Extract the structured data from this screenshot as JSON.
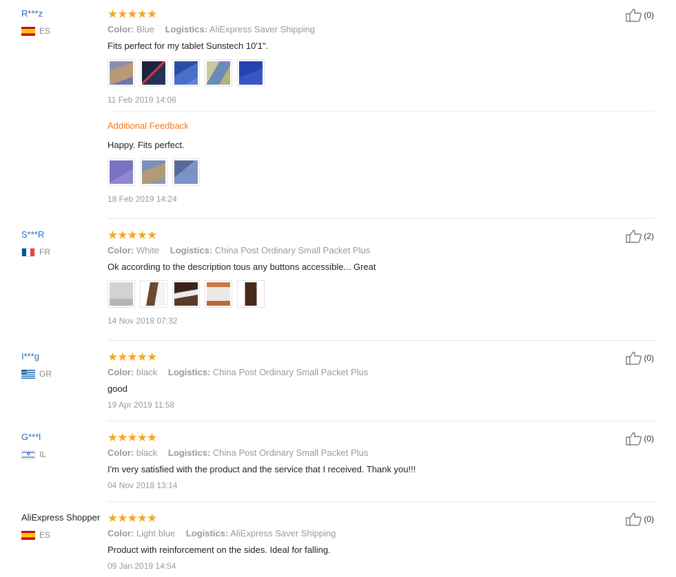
{
  "reviews": [
    {
      "user": "R***z",
      "country": "ES",
      "flag": "es",
      "stars": "★★★★★",
      "color_label": "Color:",
      "color": "Blue",
      "logistics_label": "Logistics:",
      "logistics": "AliExpress Saver Shipping",
      "text": "Fits perfect for my tablet Sunstech 10'1\".",
      "date": "11 Feb 2019 14:06",
      "helpful": "(0)",
      "additional": {
        "label": "Additional Feedback",
        "text": "Happy. Fits perfect.",
        "date": "18 Feb 2019 14:24"
      }
    },
    {
      "user": "S***R",
      "country": "FR",
      "flag": "fr",
      "stars": "★★★★★",
      "color_label": "Color:",
      "color": "White",
      "logistics_label": "Logistics:",
      "logistics": "China Post Ordinary Small Packet Plus",
      "text": "Ok according to the description tous any buttons accessible... Great",
      "date": "14 Nov 2018 07:32",
      "helpful": "(2)"
    },
    {
      "user": "I***g",
      "country": "GR",
      "flag": "gr",
      "stars": "★★★★★",
      "color_label": "Color:",
      "color": "black",
      "logistics_label": "Logistics:",
      "logistics": "China Post Ordinary Small Packet Plus",
      "text": "good",
      "date": "19 Apr 2019 11:58",
      "helpful": "(0)"
    },
    {
      "user": "G***l",
      "country": "IL",
      "flag": "il",
      "stars": "★★★★★",
      "color_label": "Color:",
      "color": "black",
      "logistics_label": "Logistics:",
      "logistics": "China Post Ordinary Small Packet Plus",
      "text": "I'm very satisfied with the product and the service that I received. Thank you!!!",
      "date": "04 Nov 2018 13:14",
      "helpful": "(0)"
    },
    {
      "user": "AliExpress Shopper",
      "country": "ES",
      "flag": "es",
      "stars": "★★★★★",
      "color_label": "Color:",
      "color": "Light blue",
      "logistics_label": "Logistics:",
      "logistics": "AliExpress Saver Shipping",
      "text": "Product with reinforcement on the sides. Ideal for falling.",
      "date": "09 Jan 2019 14:54",
      "helpful": "(0)"
    }
  ],
  "icons": {
    "thumbs_up": "thumbs-up-icon",
    "star": "star-icon"
  },
  "colors": {
    "link": "#1e6bb8",
    "star": "#f5a623",
    "additional": "#f47920"
  }
}
